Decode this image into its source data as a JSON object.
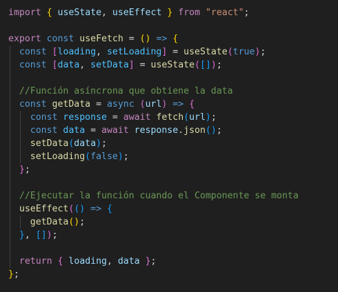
{
  "editor": {
    "lines": [
      {
        "indent": 0,
        "tokens": [
          {
            "t": "import",
            "c": "keyword"
          },
          {
            "t": " ",
            "c": "plain"
          },
          {
            "t": "{",
            "c": "bracket1"
          },
          {
            "t": " ",
            "c": "plain"
          },
          {
            "t": "useState",
            "c": "variable"
          },
          {
            "t": ", ",
            "c": "plain"
          },
          {
            "t": "useEffect",
            "c": "variable"
          },
          {
            "t": " ",
            "c": "plain"
          },
          {
            "t": "}",
            "c": "bracket1"
          },
          {
            "t": " ",
            "c": "plain"
          },
          {
            "t": "from",
            "c": "keyword"
          },
          {
            "t": " ",
            "c": "plain"
          },
          {
            "t": "\"react\"",
            "c": "string"
          },
          {
            "t": ";",
            "c": "punct"
          }
        ]
      },
      {
        "indent": 0,
        "tokens": []
      },
      {
        "indent": 0,
        "tokens": [
          {
            "t": "export",
            "c": "keyword"
          },
          {
            "t": " ",
            "c": "plain"
          },
          {
            "t": "const",
            "c": "storage"
          },
          {
            "t": " ",
            "c": "plain"
          },
          {
            "t": "useFetch",
            "c": "function"
          },
          {
            "t": " = ",
            "c": "plain"
          },
          {
            "t": "()",
            "c": "bracket1"
          },
          {
            "t": " ",
            "c": "plain"
          },
          {
            "t": "=>",
            "c": "storage"
          },
          {
            "t": " ",
            "c": "plain"
          },
          {
            "t": "{",
            "c": "bracket1"
          }
        ]
      },
      {
        "indent": 1,
        "tokens": [
          {
            "t": "const",
            "c": "storage"
          },
          {
            "t": " ",
            "c": "plain"
          },
          {
            "t": "[",
            "c": "bracket2"
          },
          {
            "t": "loading",
            "c": "const"
          },
          {
            "t": ", ",
            "c": "plain"
          },
          {
            "t": "setLoading",
            "c": "const"
          },
          {
            "t": "]",
            "c": "bracket2"
          },
          {
            "t": " = ",
            "c": "plain"
          },
          {
            "t": "useState",
            "c": "function"
          },
          {
            "t": "(",
            "c": "bracket2"
          },
          {
            "t": "true",
            "c": "storage"
          },
          {
            "t": ")",
            "c": "bracket2"
          },
          {
            "t": ";",
            "c": "punct"
          }
        ]
      },
      {
        "indent": 1,
        "tokens": [
          {
            "t": "const",
            "c": "storage"
          },
          {
            "t": " ",
            "c": "plain"
          },
          {
            "t": "[",
            "c": "bracket2"
          },
          {
            "t": "data",
            "c": "const"
          },
          {
            "t": ", ",
            "c": "plain"
          },
          {
            "t": "setData",
            "c": "const"
          },
          {
            "t": "]",
            "c": "bracket2"
          },
          {
            "t": " = ",
            "c": "plain"
          },
          {
            "t": "useState",
            "c": "function"
          },
          {
            "t": "(",
            "c": "bracket2"
          },
          {
            "t": "[]",
            "c": "bracket3"
          },
          {
            "t": ")",
            "c": "bracket2"
          },
          {
            "t": ";",
            "c": "punct"
          }
        ]
      },
      {
        "indent": 1,
        "tokens": []
      },
      {
        "indent": 1,
        "tokens": [
          {
            "t": "//Función asíncrona que obtiene la data",
            "c": "comment"
          }
        ]
      },
      {
        "indent": 1,
        "tokens": [
          {
            "t": "const",
            "c": "storage"
          },
          {
            "t": " ",
            "c": "plain"
          },
          {
            "t": "getData",
            "c": "function"
          },
          {
            "t": " = ",
            "c": "plain"
          },
          {
            "t": "async",
            "c": "storage"
          },
          {
            "t": " ",
            "c": "plain"
          },
          {
            "t": "(",
            "c": "bracket2"
          },
          {
            "t": "url",
            "c": "variable"
          },
          {
            "t": ")",
            "c": "bracket2"
          },
          {
            "t": " ",
            "c": "plain"
          },
          {
            "t": "=>",
            "c": "storage"
          },
          {
            "t": " ",
            "c": "plain"
          },
          {
            "t": "{",
            "c": "bracket2"
          }
        ]
      },
      {
        "indent": 2,
        "tokens": [
          {
            "t": "const",
            "c": "storage"
          },
          {
            "t": " ",
            "c": "plain"
          },
          {
            "t": "response",
            "c": "const"
          },
          {
            "t": " = ",
            "c": "plain"
          },
          {
            "t": "await",
            "c": "keyword"
          },
          {
            "t": " ",
            "c": "plain"
          },
          {
            "t": "fetch",
            "c": "function"
          },
          {
            "t": "(",
            "c": "bracket3"
          },
          {
            "t": "url",
            "c": "variable"
          },
          {
            "t": ")",
            "c": "bracket3"
          },
          {
            "t": ";",
            "c": "punct"
          }
        ]
      },
      {
        "indent": 2,
        "tokens": [
          {
            "t": "const",
            "c": "storage"
          },
          {
            "t": " ",
            "c": "plain"
          },
          {
            "t": "data",
            "c": "const"
          },
          {
            "t": " = ",
            "c": "plain"
          },
          {
            "t": "await",
            "c": "keyword"
          },
          {
            "t": " ",
            "c": "plain"
          },
          {
            "t": "response",
            "c": "variable"
          },
          {
            "t": ".",
            "c": "plain"
          },
          {
            "t": "json",
            "c": "function"
          },
          {
            "t": "()",
            "c": "bracket3"
          },
          {
            "t": ";",
            "c": "punct"
          }
        ]
      },
      {
        "indent": 2,
        "tokens": [
          {
            "t": "setData",
            "c": "function"
          },
          {
            "t": "(",
            "c": "bracket3"
          },
          {
            "t": "data",
            "c": "variable"
          },
          {
            "t": ")",
            "c": "bracket3"
          },
          {
            "t": ";",
            "c": "punct"
          }
        ]
      },
      {
        "indent": 2,
        "tokens": [
          {
            "t": "setLoading",
            "c": "function"
          },
          {
            "t": "(",
            "c": "bracket3"
          },
          {
            "t": "false",
            "c": "storage"
          },
          {
            "t": ")",
            "c": "bracket3"
          },
          {
            "t": ";",
            "c": "punct"
          }
        ]
      },
      {
        "indent": 1,
        "tokens": [
          {
            "t": "}",
            "c": "bracket2"
          },
          {
            "t": ";",
            "c": "punct"
          }
        ]
      },
      {
        "indent": 1,
        "tokens": []
      },
      {
        "indent": 1,
        "tokens": [
          {
            "t": "//Ejecutar la función cuando el Componente se monta",
            "c": "comment"
          }
        ]
      },
      {
        "indent": 1,
        "tokens": [
          {
            "t": "useEffect",
            "c": "function"
          },
          {
            "t": "(",
            "c": "bracket2"
          },
          {
            "t": "()",
            "c": "bracket3"
          },
          {
            "t": " ",
            "c": "plain"
          },
          {
            "t": "=>",
            "c": "storage"
          },
          {
            "t": " ",
            "c": "plain"
          },
          {
            "t": "{",
            "c": "bracket3"
          }
        ]
      },
      {
        "indent": 2,
        "tokens": [
          {
            "t": "getData",
            "c": "function"
          },
          {
            "t": "()",
            "c": "bracket1"
          },
          {
            "t": ";",
            "c": "punct"
          }
        ]
      },
      {
        "indent": 1,
        "tokens": [
          {
            "t": "}",
            "c": "bracket3"
          },
          {
            "t": ", ",
            "c": "plain"
          },
          {
            "t": "[]",
            "c": "bracket3"
          },
          {
            "t": ")",
            "c": "bracket2"
          },
          {
            "t": ";",
            "c": "punct"
          }
        ]
      },
      {
        "indent": 1,
        "tokens": []
      },
      {
        "indent": 1,
        "tokens": [
          {
            "t": "return",
            "c": "keyword"
          },
          {
            "t": " ",
            "c": "plain"
          },
          {
            "t": "{",
            "c": "bracket2"
          },
          {
            "t": " ",
            "c": "plain"
          },
          {
            "t": "loading",
            "c": "variable"
          },
          {
            "t": ", ",
            "c": "plain"
          },
          {
            "t": "data",
            "c": "variable"
          },
          {
            "t": " ",
            "c": "plain"
          },
          {
            "t": "}",
            "c": "bracket2"
          },
          {
            "t": ";",
            "c": "punct"
          }
        ]
      },
      {
        "indent": 0,
        "tokens": [
          {
            "t": "}",
            "c": "bracket1"
          },
          {
            "t": ";",
            "c": "punct"
          }
        ]
      }
    ]
  }
}
